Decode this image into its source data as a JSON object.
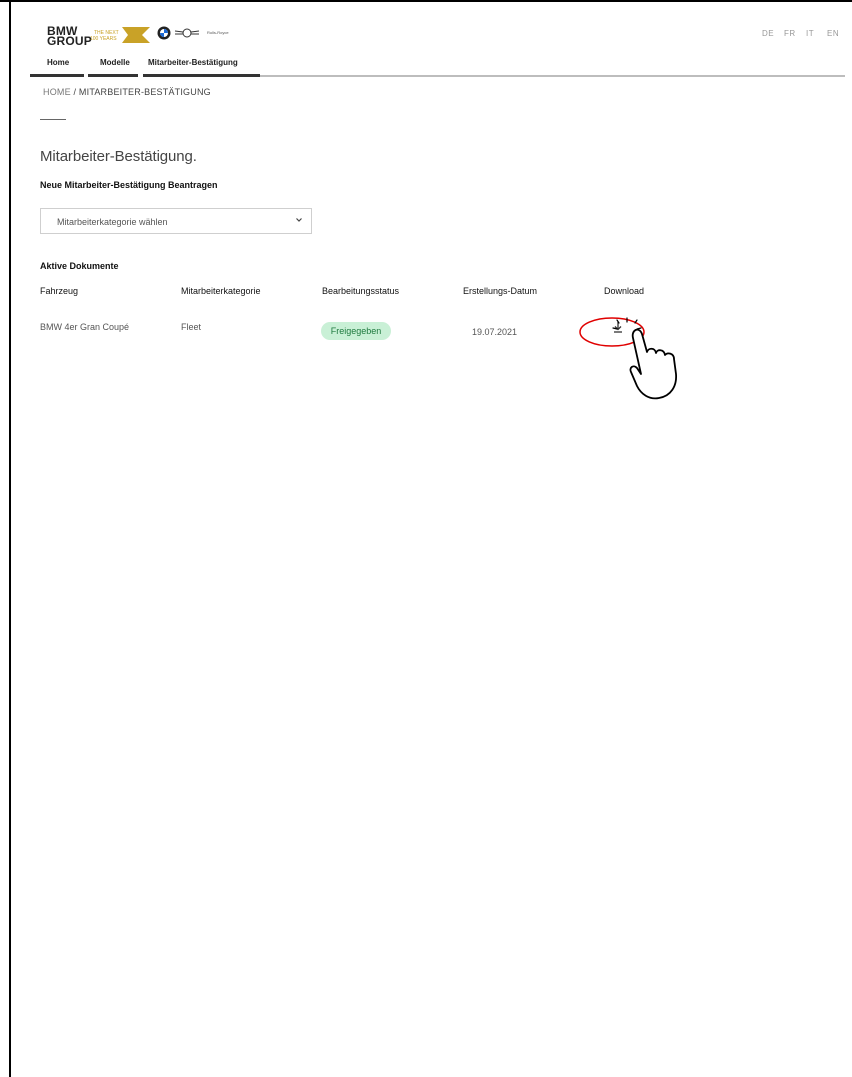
{
  "header": {
    "logo_line1": "BMW",
    "logo_line2": "GROUP",
    "slogan_line1": "THE NEXT",
    "slogan_line2": "100 YEARS",
    "brand_text": "Rolls-Royce",
    "languages": [
      "DE",
      "FR",
      "IT",
      "EN"
    ]
  },
  "nav": {
    "items": [
      "Home",
      "Modelle",
      "Mitarbeiter-Bestätigung"
    ]
  },
  "breadcrumb": {
    "root": "HOME",
    "separator": "/",
    "current": "MITARBEITER-BESTÄTIGUNG"
  },
  "page": {
    "title": "Mitarbeiter-Bestätigung.",
    "subtitle": "Neue Mitarbeiter-Bestätigung Beantragen",
    "select_value": "Mitarbeiterkategorie wählen",
    "section_title": "Aktive Dokumente"
  },
  "table": {
    "headers": [
      "Fahrzeug",
      "Mitarbeiterkategorie",
      "Bearbeitungsstatus",
      "Erstellungs-Datum",
      "Download"
    ],
    "rows": [
      {
        "fahrzeug": "BMW 4er Gran Coupé",
        "kategorie": "Fleet",
        "status": "Freigegeben",
        "datum": "19.07.2021"
      }
    ]
  },
  "colors": {
    "status_badge_bg": "#c9f0d6",
    "status_badge_text": "#1f7a3f",
    "highlight_circle": "#e00000",
    "gold": "#c9a227"
  },
  "icons": [
    "chevron-down-icon",
    "download-icon",
    "pointing-hand-icon"
  ]
}
